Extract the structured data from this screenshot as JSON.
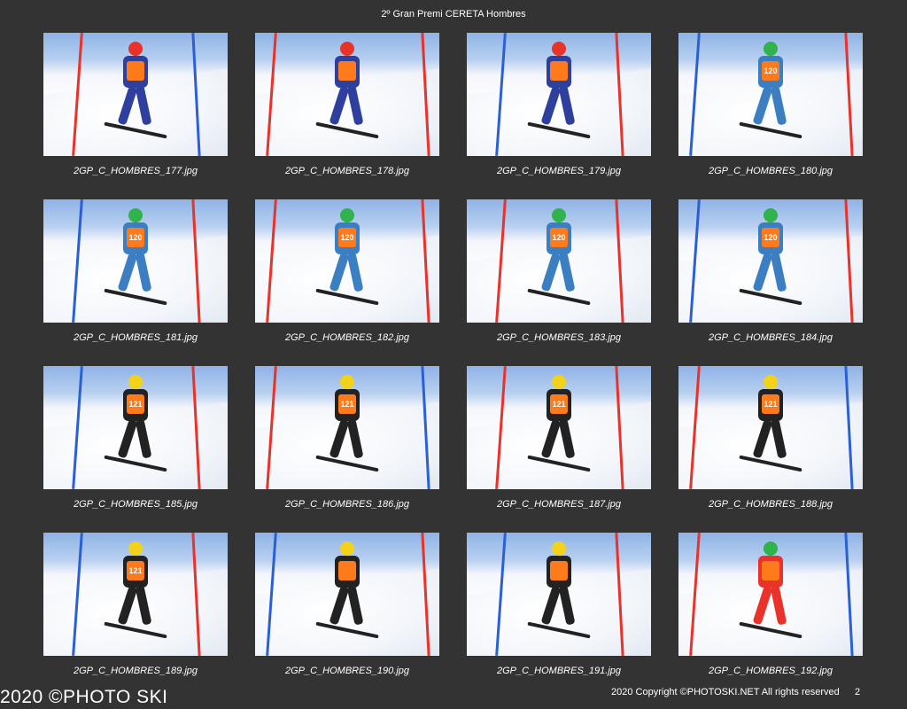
{
  "page": {
    "title": "2º Gran Premi CERETA Hombres",
    "footer_left": "2020 ©PHOTO SKI",
    "footer_right": "2020 Copyright ©PHOTOSKI.NET All rights reserved",
    "page_number": "2"
  },
  "colors": {
    "background": "#333333",
    "text": "#ffffff",
    "gate_red": "#e8322a",
    "gate_blue": "#2a5fd6"
  },
  "thumbnails": [
    {
      "filename": "2GP_C_HOMBRES_177.jpg",
      "bib": "",
      "helmet": "#e8322a",
      "suit": "#2e3f9e",
      "poles": [
        "#e8322a",
        "#2a5fd6"
      ]
    },
    {
      "filename": "2GP_C_HOMBRES_178.jpg",
      "bib": "",
      "helmet": "#e8322a",
      "suit": "#2e3f9e",
      "poles": [
        "#e8322a",
        "#e8322a"
      ]
    },
    {
      "filename": "2GP_C_HOMBRES_179.jpg",
      "bib": "",
      "helmet": "#e8322a",
      "suit": "#2e3f9e",
      "poles": [
        "#2a5fd6",
        "#e8322a"
      ]
    },
    {
      "filename": "2GP_C_HOMBRES_180.jpg",
      "bib": "120",
      "helmet": "#2fb34a",
      "suit": "#3b7fc2",
      "poles": [
        "#2a5fd6",
        "#e8322a"
      ]
    },
    {
      "filename": "2GP_C_HOMBRES_181.jpg",
      "bib": "120",
      "helmet": "#2fb34a",
      "suit": "#3b7fc2",
      "poles": [
        "#2a5fd6",
        "#e8322a"
      ]
    },
    {
      "filename": "2GP_C_HOMBRES_182.jpg",
      "bib": "120",
      "helmet": "#2fb34a",
      "suit": "#3b7fc2",
      "poles": [
        "#e8322a",
        "#e8322a"
      ]
    },
    {
      "filename": "2GP_C_HOMBRES_183.jpg",
      "bib": "120",
      "helmet": "#2fb34a",
      "suit": "#3b7fc2",
      "poles": [
        "#e8322a",
        "#e8322a"
      ]
    },
    {
      "filename": "2GP_C_HOMBRES_184.jpg",
      "bib": "120",
      "helmet": "#2fb34a",
      "suit": "#3b7fc2",
      "poles": [
        "#2a5fd6",
        "#e8322a"
      ]
    },
    {
      "filename": "2GP_C_HOMBRES_185.jpg",
      "bib": "121",
      "helmet": "#f2d21b",
      "suit": "#222222",
      "poles": [
        "#2a5fd6",
        "#e8322a"
      ]
    },
    {
      "filename": "2GP_C_HOMBRES_186.jpg",
      "bib": "121",
      "helmet": "#f2d21b",
      "suit": "#222222",
      "poles": [
        "#e8322a",
        "#2a5fd6"
      ]
    },
    {
      "filename": "2GP_C_HOMBRES_187.jpg",
      "bib": "121",
      "helmet": "#f2d21b",
      "suit": "#222222",
      "poles": [
        "#e8322a",
        "#e8322a"
      ]
    },
    {
      "filename": "2GP_C_HOMBRES_188.jpg",
      "bib": "121",
      "helmet": "#f2d21b",
      "suit": "#222222",
      "poles": [
        "#e8322a",
        "#2a5fd6"
      ]
    },
    {
      "filename": "2GP_C_HOMBRES_189.jpg",
      "bib": "121",
      "helmet": "#f2d21b",
      "suit": "#222222",
      "poles": [
        "#2a5fd6",
        "#e8322a"
      ]
    },
    {
      "filename": "2GP_C_HOMBRES_190.jpg",
      "bib": "",
      "helmet": "#f2d21b",
      "suit": "#222222",
      "poles": [
        "#2a5fd6",
        "#e8322a"
      ]
    },
    {
      "filename": "2GP_C_HOMBRES_191.jpg",
      "bib": "",
      "helmet": "#f2d21b",
      "suit": "#222222",
      "poles": [
        "#2a5fd6",
        "#e8322a"
      ]
    },
    {
      "filename": "2GP_C_HOMBRES_192.jpg",
      "bib": "",
      "helmet": "#2fb34a",
      "suit": "#e8322a",
      "poles": [
        "#e8322a",
        "#2a5fd6"
      ]
    }
  ]
}
